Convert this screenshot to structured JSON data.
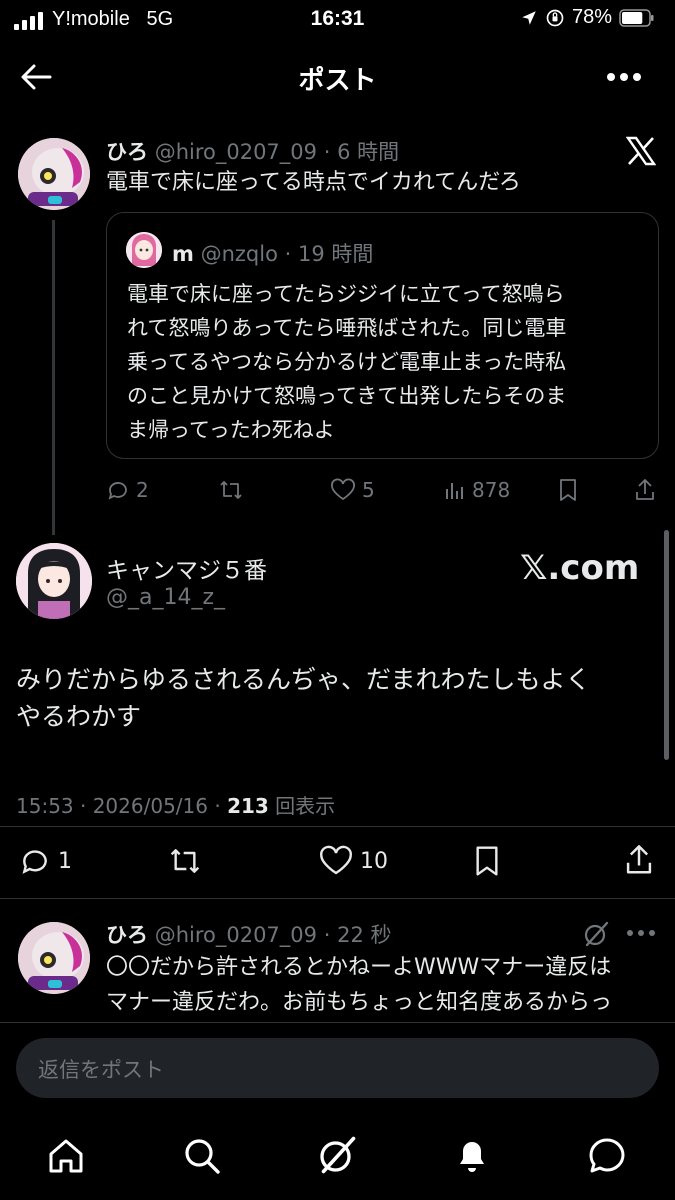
{
  "status_bar": {
    "carrier": "Y!mobile",
    "network": "5G",
    "time": "16:31",
    "battery": "78%",
    "battery_level": 0.78
  },
  "header": {
    "title": "ポスト",
    "back_icon": "arrow-left-icon",
    "more_icon": "more-horizontal-icon"
  },
  "parent_post": {
    "name": "ひろ",
    "handle": "@hiro_0207_09",
    "dot": "·",
    "time": "6 時間",
    "text": "電車で床に座ってる時点でイカれてんだろ",
    "badge_icon": "x-logo-icon",
    "quote": {
      "name": "m",
      "handle": "@nzqlo",
      "dot": "·",
      "time": "19 時間",
      "text_lines": [
        "電車で床に座ってたらジジイに立てって怒鳴ら",
        "れて怒鳴りあってたら唾飛ばされた。同じ電車",
        "乗ってるやつなら分かるけど電車止まった時私",
        "のこと見かけて怒鳴ってきて出発したらそのま",
        "ま帰ってったわ死ねよ"
      ]
    },
    "actions": {
      "replies": "2",
      "likes": "5",
      "views": "878"
    }
  },
  "main_post": {
    "name": "キャンマジ５番",
    "handle": "@_a_14_z_",
    "watermark": "𝕏.com",
    "text_lines": [
      "みりだからゆるされるんぢゃ、だまれわたしもよく",
      "やるわかす"
    ],
    "timestamp": "15:53 · 2026/05/16 · ",
    "views_count": "213",
    "views_label": " 回表示",
    "actions": {
      "replies": "1",
      "likes": "10"
    }
  },
  "reply_post": {
    "name": "ひろ",
    "handle": "@hiro_0207_09",
    "dot": "·",
    "time": "22 秒",
    "text_lines": [
      "〇〇だから許されるとかねーよWWWマナー違反は",
      "マナー違反だわ。お前もちょっと知名度あるからっ"
    ],
    "badge_icon": "grok-icon"
  },
  "reply_input": {
    "placeholder": "返信をポスト"
  },
  "bottom_nav": {
    "items": [
      "home-icon",
      "search-icon",
      "grok-icon",
      "notifications-icon",
      "messages-icon"
    ]
  }
}
